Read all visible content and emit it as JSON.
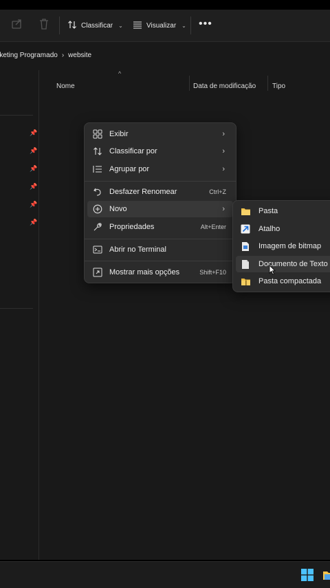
{
  "toolbar": {
    "sort_label": "Classificar",
    "view_label": "Visualizar",
    "more_label": "•••"
  },
  "address": {
    "segments": [
      "rketing Programado",
      "website"
    ],
    "separator": "›"
  },
  "columns": {
    "name": "Nome",
    "date_modified": "Data de modificação",
    "type": "Tipo"
  },
  "context_menu": {
    "items": [
      {
        "label": "Exibir",
        "icon": "grid-icon",
        "has_submenu": true
      },
      {
        "label": "Classificar por",
        "icon": "sort-icon",
        "has_submenu": true
      },
      {
        "label": "Agrupar por",
        "icon": "list-icon",
        "has_submenu": true
      },
      {
        "label": "Desfazer Renomear",
        "icon": "undo-icon",
        "shortcut": "Ctrl+Z"
      },
      {
        "label": "Novo",
        "icon": "plus-circle-icon",
        "has_submenu": true
      },
      {
        "label": "Propriedades",
        "icon": "wrench-icon",
        "shortcut": "Alt+Enter"
      },
      {
        "label": "Abrir no Terminal",
        "icon": "terminal-icon"
      },
      {
        "label": "Mostrar mais opções",
        "icon": "expand-icon",
        "shortcut": "Shift+F10"
      }
    ]
  },
  "new_submenu": {
    "items": [
      {
        "label": "Pasta",
        "icon": "folder-icon"
      },
      {
        "label": "Atalho",
        "icon": "shortcut-icon"
      },
      {
        "label": "Imagem de bitmap",
        "icon": "bitmap-icon"
      },
      {
        "label": "Documento de Texto",
        "icon": "text-document-icon"
      },
      {
        "label": "Pasta compactada",
        "icon": "zip-folder-icon"
      }
    ]
  },
  "colors": {
    "background": "#191919",
    "menu": "#2b2b2b",
    "folder": "#f3c34a",
    "shortcut_arrow": "#4aa3ff"
  }
}
